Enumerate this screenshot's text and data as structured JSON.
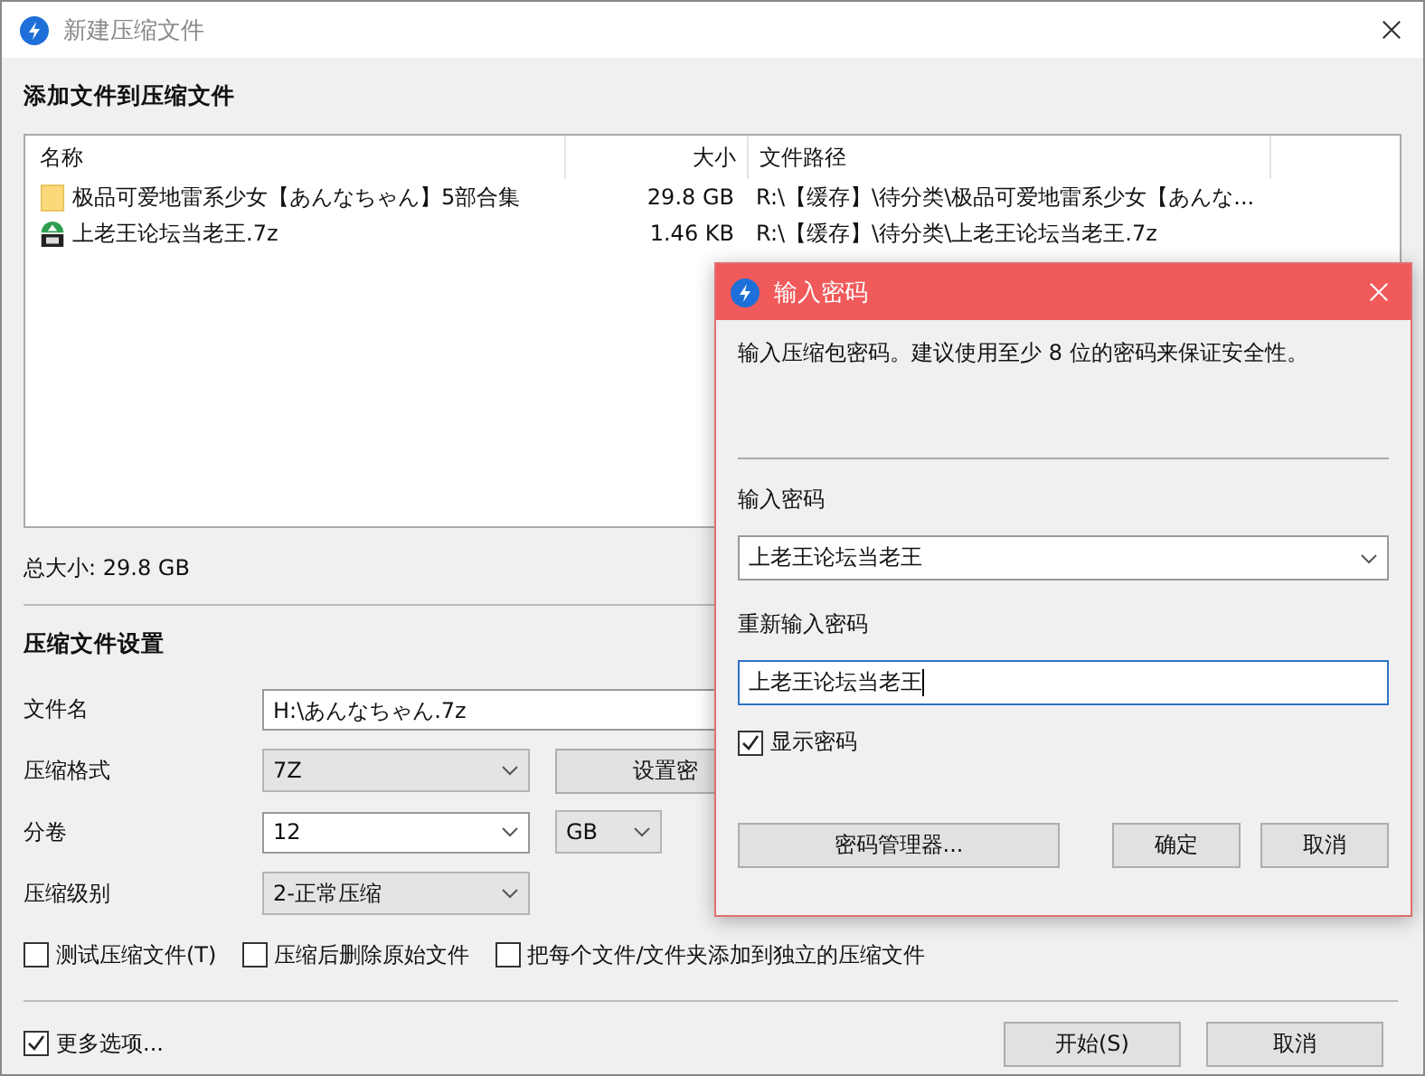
{
  "window": {
    "title": "新建压缩文件"
  },
  "files_section": {
    "heading": "添加文件到压缩文件",
    "columns": [
      "名称",
      "大小",
      "文件路径"
    ],
    "rows": [
      {
        "kind": "folder",
        "name": "极品可爱地雷系少女【あんなちゃん】5部合集",
        "size": "29.8 GB",
        "path": "R:\\【缓存】\\待分类\\极品可爱地雷系少女【あんな..."
      },
      {
        "kind": "archive",
        "name": "上老王论坛当老王.7z",
        "size": "1.46 KB",
        "path": "R:\\【缓存】\\待分类\\上老王论坛当老王.7z"
      }
    ],
    "total": "总大小: 29.8 GB"
  },
  "settings": {
    "heading": "压缩文件设置",
    "filename": {
      "label": "文件名",
      "value": "H:\\あんなちゃん.7z"
    },
    "format": {
      "label": "压缩格式",
      "value": "7Z",
      "password_button": "设置密"
    },
    "split": {
      "label": "分卷",
      "value": "12",
      "unit": "GB"
    },
    "level": {
      "label": "压缩级别",
      "value": "2-正常压缩"
    },
    "options": [
      {
        "label": "测试压缩文件(T)",
        "checked": false
      },
      {
        "label": "压缩后删除原始文件",
        "checked": false
      },
      {
        "label": "把每个文件/文件夹添加到独立的压缩文件",
        "checked": false
      }
    ]
  },
  "more_options": {
    "label": "更多选项...",
    "checked": true
  },
  "buttons": [
    "开始(S)",
    "取消"
  ],
  "password_dialog": {
    "title": "输入密码",
    "hint": "输入压缩包密码。建议使用至少 8 位的密码来保证安全性。",
    "password_label": "输入密码",
    "password": "上老王论坛当老王",
    "repeat_label": "重新输入密码",
    "repeat": "上老王论坛当老王",
    "show_password": {
      "label": "显示密码",
      "checked": true
    },
    "buttons": [
      "密码管理器...",
      "确定",
      "取消"
    ]
  }
}
